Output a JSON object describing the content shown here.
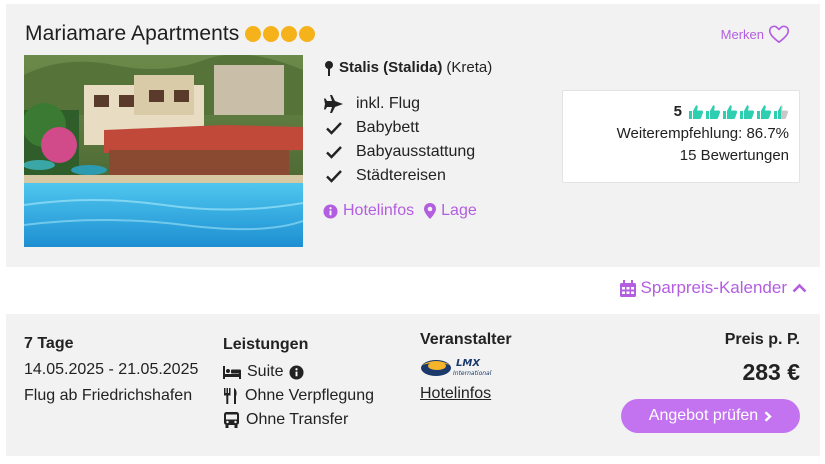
{
  "hotel": {
    "name": "Mariamare Apartments",
    "stars": 4,
    "star_color": "#f6b21a",
    "merken_label": "Merken",
    "location_main": "Stalis (Stalida)",
    "location_region": "(Kreta)",
    "features": [
      {
        "icon": "plane-icon",
        "label": "inkl. Flug"
      },
      {
        "icon": "check-icon",
        "label": "Babybett"
      },
      {
        "icon": "check-icon",
        "label": "Babyausstattung"
      },
      {
        "icon": "check-icon",
        "label": "Städtereisen"
      }
    ],
    "links": {
      "hotelinfos": "Hotelinfos",
      "lage": "Lage"
    }
  },
  "rating": {
    "score": "5",
    "thumbs_filled": 5.5,
    "thumbs_total": 6,
    "recommendation": "Weiterempfehlung: 86.7%",
    "reviews": "15 Bewertungen",
    "thumb_color": "#2ecfb0"
  },
  "calendar": {
    "label": "Sparpreis-Kalender"
  },
  "offer": {
    "duration": "7 Tage",
    "dates": "14.05.2025 - 21.05.2025",
    "departure": "Flug ab Friedrichshafen",
    "services_header": "Leistungen",
    "room": "Suite",
    "board": "Ohne Verpflegung",
    "transfer": "Ohne Transfer",
    "operator_header": "Veranstalter",
    "operator_logo_text": "LMX",
    "operator_logo_sub": "International",
    "operator_hotelinfos": "Hotelinfos",
    "price_header": "Preis p. P.",
    "price": "283 €",
    "cta": "Angebot prüfen"
  },
  "colors": {
    "accent": "#b35ee0",
    "button": "#c473f0",
    "card_bg": "#f2f2f2"
  }
}
